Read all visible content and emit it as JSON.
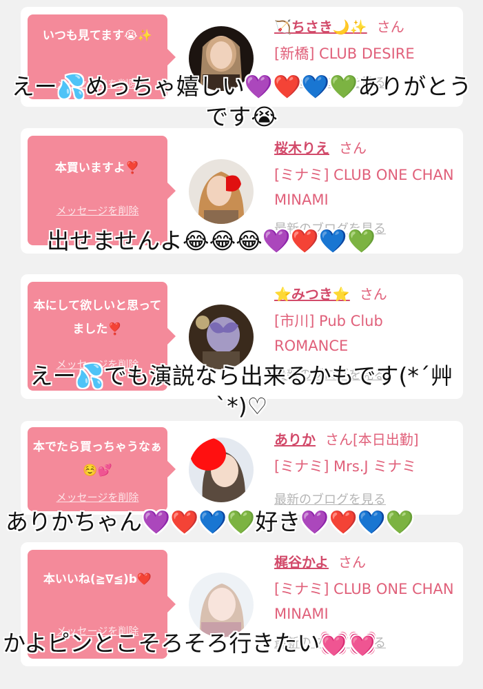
{
  "cards": [
    {
      "message": "いつも見てます😭✨",
      "delete_label": "メッセージを削除",
      "name": "🏹ちさき🌙✨",
      "honorific": "さん",
      "shop": "[新橋] CLUB DESIRE",
      "blog_label": "最新のブログを見る",
      "overlay": "えー💦めっちゃ嬉しい💜❤️💙💚ありがとうです😭"
    },
    {
      "message": "本買いますよ❣️",
      "delete_label": "メッセージを削除",
      "name": "桜木りえ",
      "honorific": "さん",
      "shop": "[ミナミ] CLUB ONE CHAN MINAMI",
      "blog_label": "最新のブログを見る",
      "overlay": "出せませんよ😂😂😂💜❤️💙💚"
    },
    {
      "message": "本にして欲しいと思ってました❣️",
      "delete_label": "メッセージを削除",
      "name": "⭐みつき⭐",
      "honorific": "さん",
      "shop": "[市川] Pub Club ROMANCE",
      "blog_label": "最新のブログを見る",
      "overlay": "えー💦でも演説なら出来るかもです(*´艸`*)♡"
    },
    {
      "message": "本でたら買っちゃうなぁ☺️💕",
      "delete_label": "メッセージを削除",
      "name": "ありか",
      "honorific": "さん[本日出勤]",
      "shop": "[ミナミ] Mrs.J ミナミ",
      "blog_label": "最新のブログを見る",
      "overlay": "ありかちゃん💜❤️💙💚好き💜❤️💙💚"
    },
    {
      "message": "本いいね(≧∇≦)b❤️",
      "delete_label": "メッセージを削除",
      "name": "梶谷かよ",
      "honorific": "さん",
      "shop": "[ミナミ] CLUB ONE CHAN MINAMI",
      "blog_label": "最新のブログを見る",
      "overlay": "かよピンとこそろそろ行きたい💓💓"
    }
  ],
  "colors": {
    "accent": "#f48a9a",
    "name": "#d24a6a",
    "text": "#e0607a",
    "muted": "#b5b5b5",
    "background": "#f1f1f1"
  }
}
